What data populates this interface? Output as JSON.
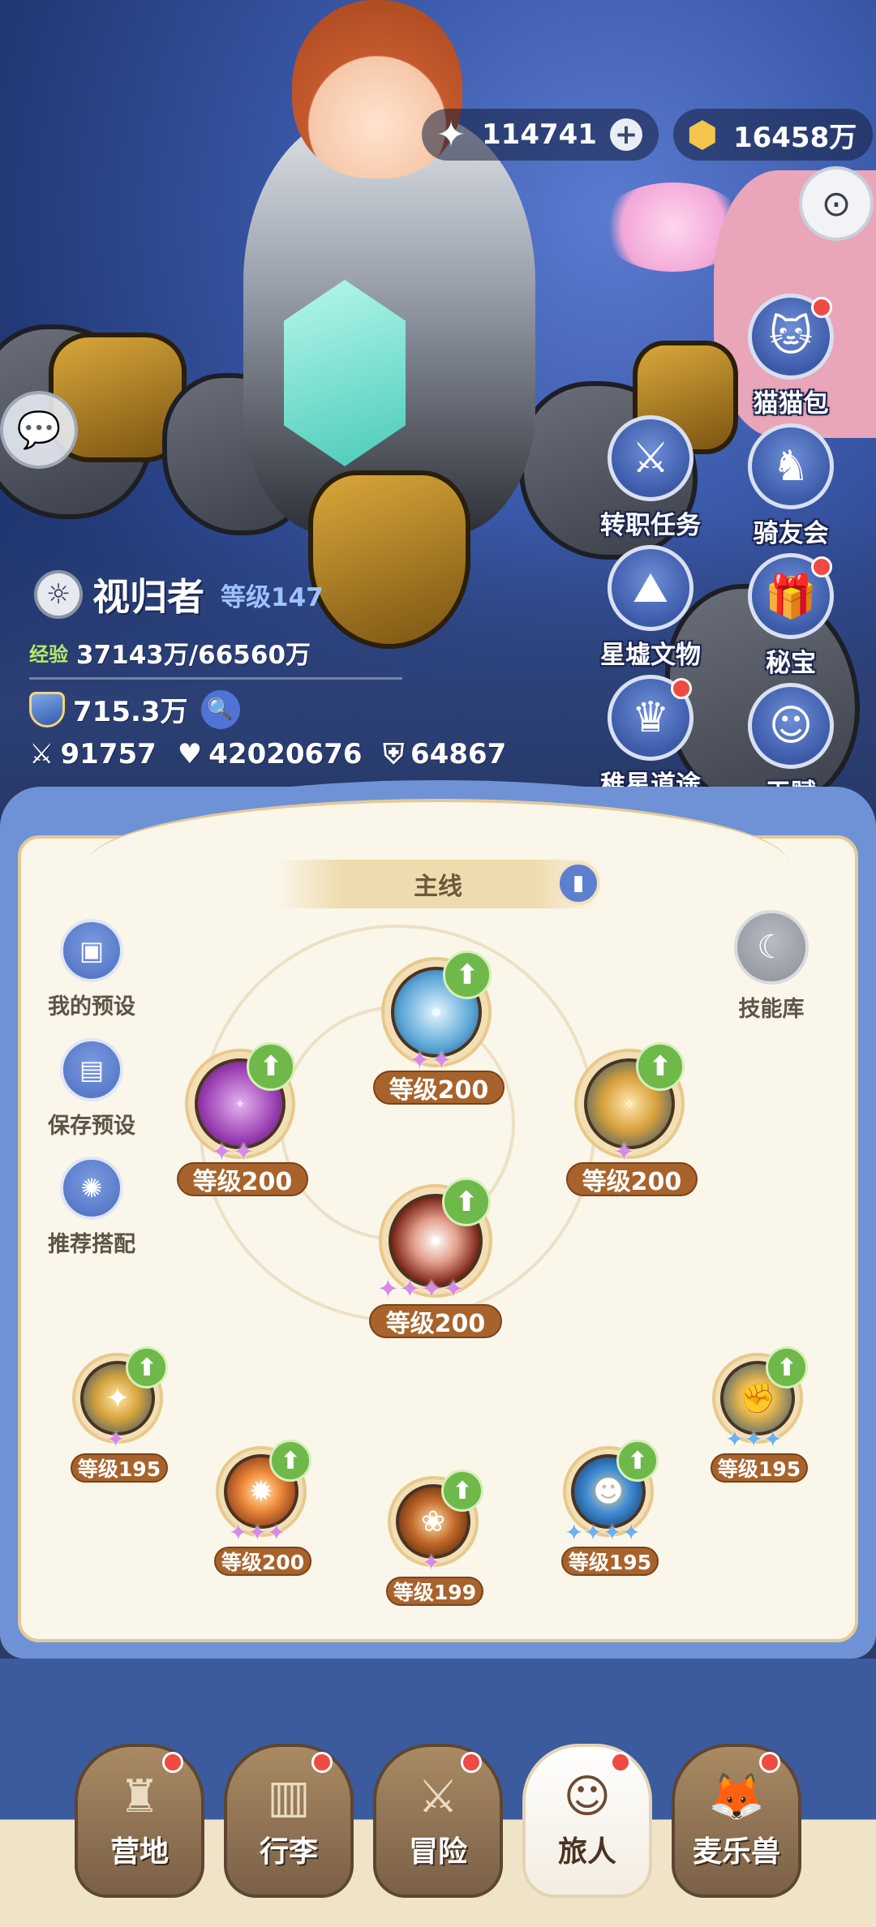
{
  "currency": {
    "star_icon": "star-crystal-icon",
    "star_value": "114741",
    "gold_icon": "gold-coin-icon",
    "gold_value": "16458万"
  },
  "side_menu": {
    "col_right": [
      {
        "label": "猫猫包",
        "icon": "cat-bag-icon",
        "badge": true
      },
      {
        "label": "骑友会",
        "icon": "horse-icon",
        "badge": false
      },
      {
        "label": "秘宝",
        "icon": "treasure-icon",
        "badge": true
      },
      {
        "label": "天赋",
        "icon": "brain-head-icon",
        "badge": false
      }
    ],
    "col_left": [
      {
        "label": "转职任务",
        "icon": "class-change-icon",
        "badge": false
      },
      {
        "label": "星墟文物",
        "icon": "artifact-icon",
        "badge": false
      },
      {
        "label": "稚星道途",
        "icon": "star-path-icon",
        "badge": true
      }
    ]
  },
  "player": {
    "name": "视归者",
    "level": "等级147",
    "exp_tag": "经验",
    "exp": "37143万/66560万",
    "power": "715.3万",
    "attack": "91757",
    "hp": "42020676",
    "defense": "64867"
  },
  "panel": {
    "tab": "主线",
    "my_preset": "我的预设",
    "save_preset": "保存预设",
    "recommend": "推荐搭配",
    "skill_library": "技能库"
  },
  "skills": {
    "top": {
      "level": "等级200",
      "stars": 2
    },
    "left": {
      "level": "等级200",
      "stars": 2
    },
    "right": {
      "level": "等级200",
      "stars": 1
    },
    "center": {
      "level": "等级200",
      "stars": 4
    },
    "b1": {
      "level": "等级195",
      "stars": 1
    },
    "b2": {
      "level": "等级200",
      "stars": 3
    },
    "b3": {
      "level": "等级199",
      "stars": 1
    },
    "b4": {
      "level": "等级195",
      "stars": 4
    },
    "b5": {
      "level": "等级195",
      "stars": 3
    }
  },
  "nav": {
    "camp": "营地",
    "bag": "行李",
    "adventure": "冒险",
    "traveler": "旅人",
    "pet": "麦乐兽"
  }
}
